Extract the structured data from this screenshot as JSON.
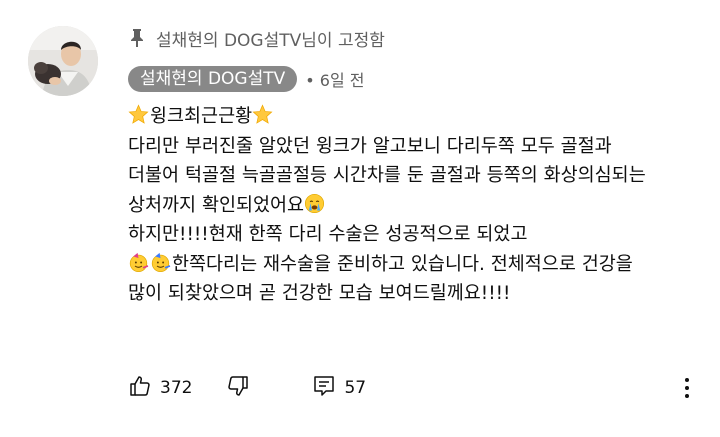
{
  "comment": {
    "pinned_label": "설채현의 DOG설TV님이 고정함",
    "author": "설채현의 DOG설TV",
    "time": "• 6일 전",
    "lines": [
      "윙크최근근황",
      "다리만 부러진줄 알았던 윙크가 알고보니 다리두쪽 모두 골절과",
      "더불어 턱골절 늑골골절등 시간차를 둔 골절과 등쪽의 화상의심되는",
      "상처까지 확인되었어요",
      "하지만!!!!현재 한쪽 다리 수술은 성공적으로 되었고",
      "한쪽다리는 재수술을 준비하고 있습니다. 전체적으로 건강을",
      "많이 되찾았으며 곧 건강한 모습 보여드릴께요!!!!"
    ],
    "emojis": {
      "line1_prefix": "star-emoji",
      "line1_suffix": "star-emoji",
      "line4_suffix": "crying-face-emoji",
      "line6_prefix": "party-face-emoji"
    },
    "like_count": "372",
    "reply_count": "57"
  },
  "colors": {
    "author_chip_bg": "#888888",
    "secondary_text": "#606060",
    "primary_text": "#0f0f0f"
  },
  "icons": {
    "pin": "pin-icon",
    "like": "thumbs-up-icon",
    "dislike": "thumbs-down-icon",
    "reply": "reply-icon",
    "more": "more-vert-icon"
  }
}
